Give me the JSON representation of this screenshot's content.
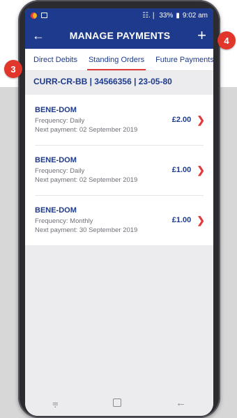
{
  "statusbar": {
    "signal": "☷.❘",
    "battery": "33%",
    "time": "9:02 am"
  },
  "appbar": {
    "back_icon": "←",
    "title": "MANAGE PAYMENTS",
    "add_icon": "+"
  },
  "tabs": [
    {
      "label": "Direct Debits"
    },
    {
      "label": "Standing Orders"
    },
    {
      "label": "Future Payments"
    }
  ],
  "account": "CURR-CR-BB | 34566356 | 23-05-80",
  "orders": [
    {
      "name": "BENE-DOM",
      "frequency": "Frequency: Daily",
      "next": "Next payment: 02 September 2019",
      "amount": "£2.00"
    },
    {
      "name": "BENE-DOM",
      "frequency": "Frequency: Daily",
      "next": "Next payment: 02 September 2019",
      "amount": "£1.00"
    },
    {
      "name": "BENE-DOM",
      "frequency": "Frequency: Monthly",
      "next": "Next payment: 30 September 2019",
      "amount": "£1.00"
    }
  ],
  "chevron": "❯",
  "navbar": {
    "back": "←",
    "home_icon": "recents-square-icon",
    "recent": "⩦"
  },
  "badges": {
    "tabs": "3",
    "add": "4"
  },
  "colors": {
    "primary": "#1d3a8c",
    "accent": "#e03b3b",
    "badge": "#e0362c"
  }
}
